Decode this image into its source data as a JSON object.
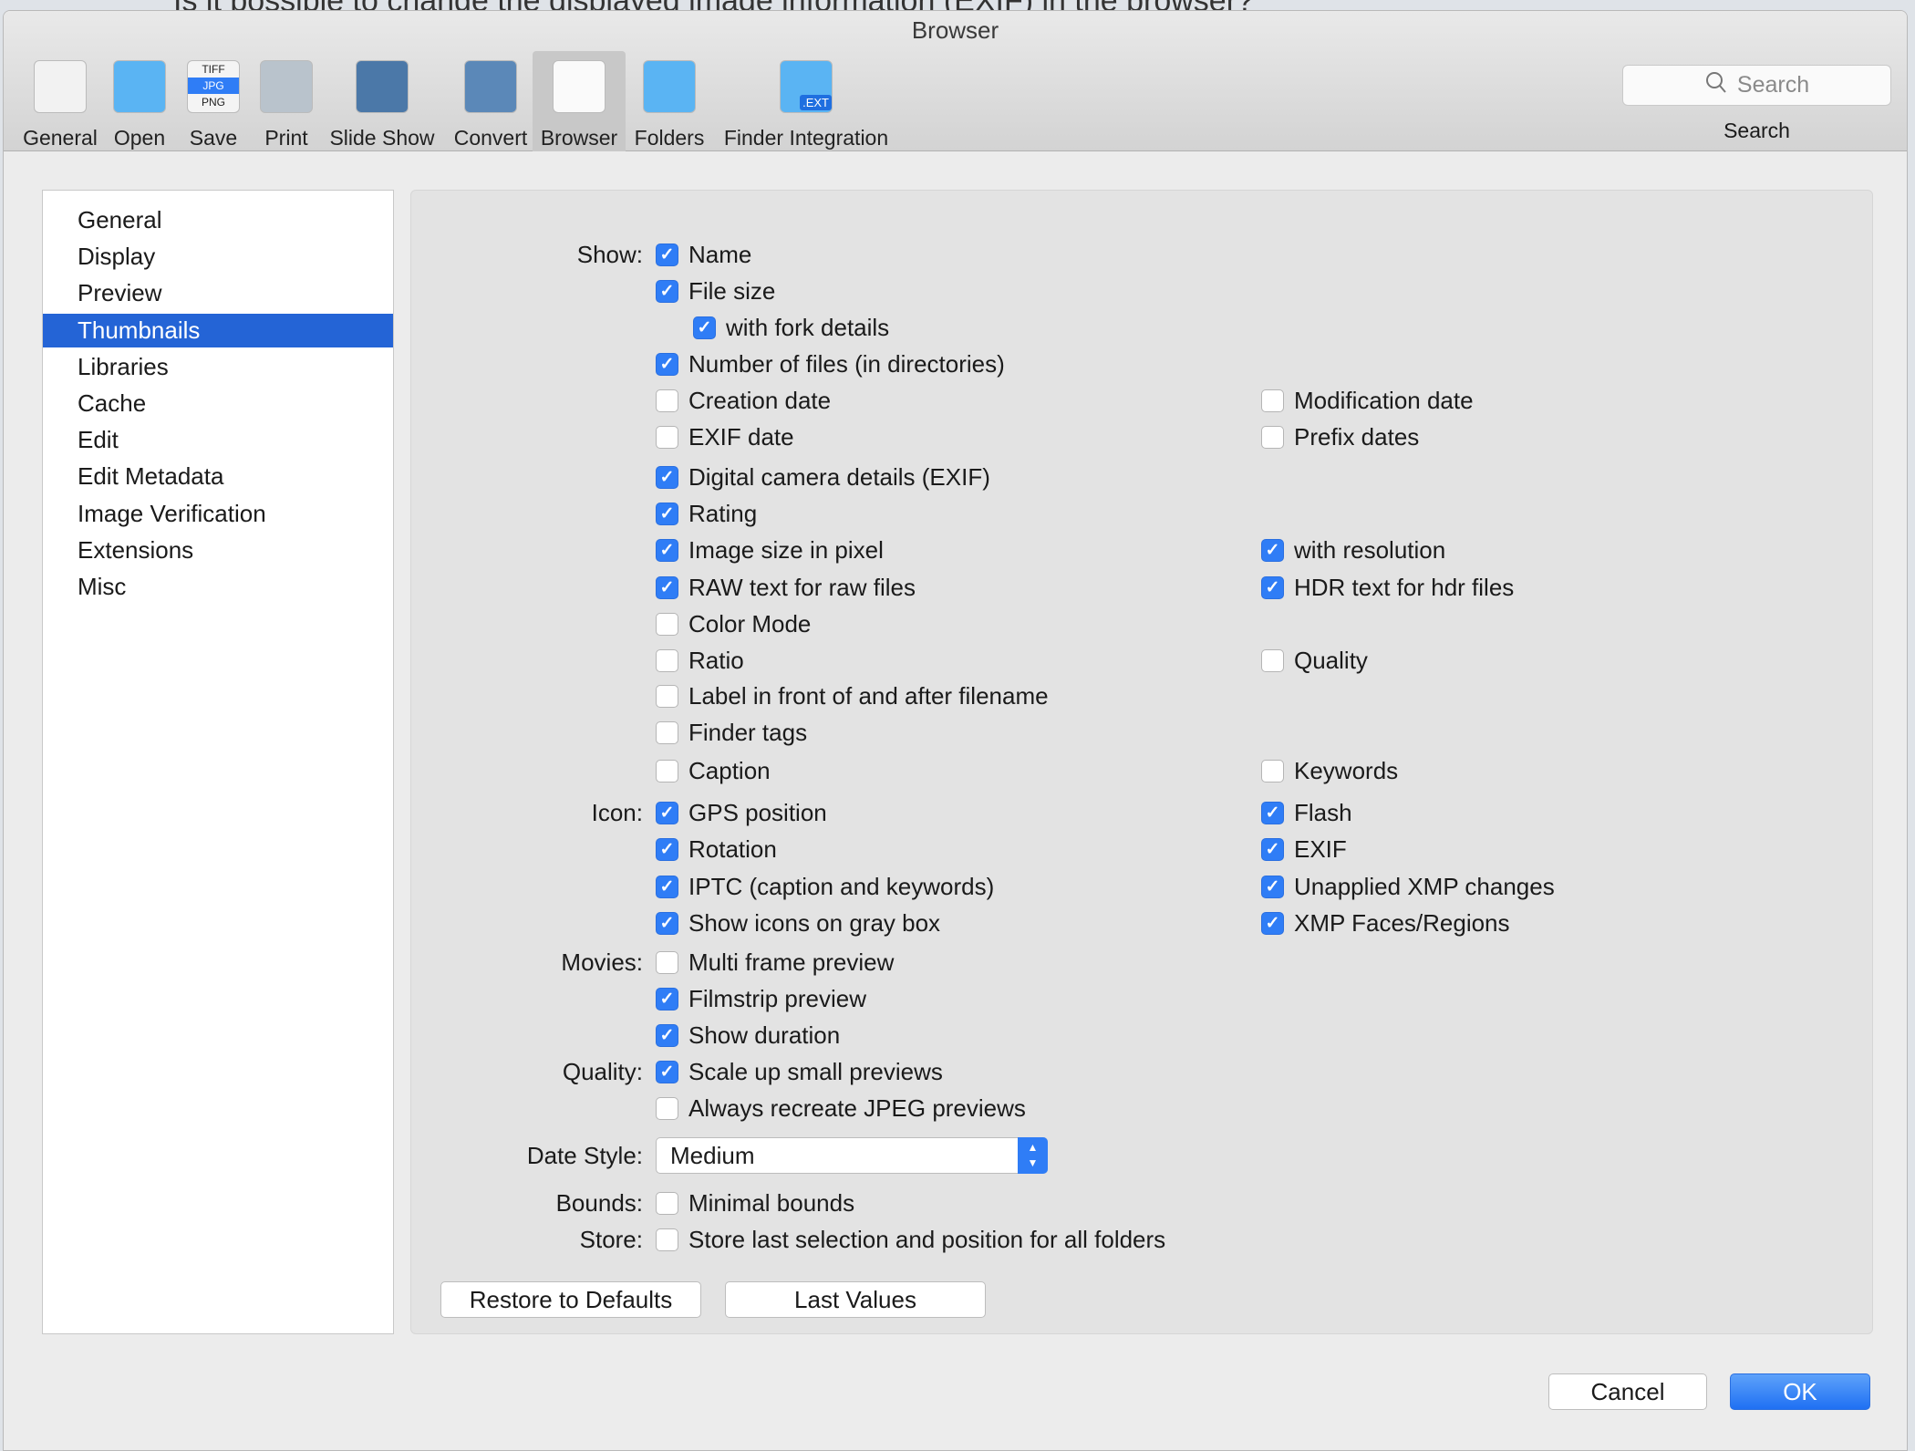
{
  "background_question": "Is it possible to change the displayed image information (EXIF) in the browser?",
  "window": {
    "title": "Browser"
  },
  "toolbar": {
    "items": [
      {
        "label": "General",
        "icon": "switch-icon"
      },
      {
        "label": "Open",
        "icon": "folder-brush-icon"
      },
      {
        "label": "Save",
        "icon": "file-formats-icon",
        "formats": [
          "TIFF",
          "JPG",
          "PNG"
        ]
      },
      {
        "label": "Print",
        "icon": "printer-icon"
      },
      {
        "label": "Slide Show",
        "icon": "slideshow-icon"
      },
      {
        "label": "Convert",
        "icon": "convert-icon"
      },
      {
        "label": "Browser",
        "icon": "browser-icon",
        "selected": true
      },
      {
        "label": "Folders",
        "icon": "folder-photo-icon"
      },
      {
        "label": "Finder Integration",
        "icon": "finder-ext-icon",
        "badge": ".EXT"
      }
    ],
    "search": {
      "placeholder": "Search",
      "label": "Search"
    }
  },
  "sidebar": {
    "items": [
      "General",
      "Display",
      "Preview",
      "Thumbnails",
      "Libraries",
      "Cache",
      "Edit",
      "Edit Metadata",
      "Image Verification",
      "Extensions",
      "Misc"
    ],
    "selected": "Thumbnails"
  },
  "rows": [
    {
      "group": "Show:",
      "left": {
        "label": "Name",
        "checked": true
      }
    },
    {
      "left": {
        "label": "File size",
        "checked": true
      }
    },
    {
      "left": {
        "label": "with fork details",
        "checked": true,
        "indent": true
      }
    },
    {
      "left": {
        "label": "Number of files (in directories)",
        "checked": true
      }
    },
    {
      "left": {
        "label": "Creation date",
        "checked": false
      },
      "right": {
        "label": "Modification date",
        "checked": false
      }
    },
    {
      "left": {
        "label": "EXIF date",
        "checked": false
      },
      "right": {
        "label": "Prefix dates",
        "checked": false
      }
    },
    {
      "left": {
        "label": "Digital camera details (EXIF)",
        "checked": true
      }
    },
    {
      "left": {
        "label": "Rating",
        "checked": true
      }
    },
    {
      "left": {
        "label": "Image size in pixel",
        "checked": true
      },
      "right": {
        "label": "with resolution",
        "checked": true
      }
    },
    {
      "left": {
        "label": "RAW text for raw files",
        "checked": true
      },
      "right": {
        "label": "HDR text for hdr files",
        "checked": true
      }
    },
    {
      "left": {
        "label": "Color Mode",
        "checked": false
      }
    },
    {
      "left": {
        "label": "Ratio",
        "checked": false
      },
      "right": {
        "label": "Quality",
        "checked": false
      }
    },
    {
      "left": {
        "label": "Label in front of and after filename",
        "checked": false
      }
    },
    {
      "left": {
        "label": "Finder tags",
        "checked": false
      }
    },
    {
      "left": {
        "label": "Caption",
        "checked": false
      },
      "right": {
        "label": "Keywords",
        "checked": false
      }
    },
    {
      "group": "Icon:",
      "left": {
        "label": "GPS position",
        "checked": true
      },
      "right": {
        "label": "Flash",
        "checked": true
      }
    },
    {
      "left": {
        "label": "Rotation",
        "checked": true
      },
      "right": {
        "label": "EXIF",
        "checked": true
      }
    },
    {
      "left": {
        "label": "IPTC (caption and keywords)",
        "checked": true
      },
      "right": {
        "label": "Unapplied XMP changes",
        "checked": true
      }
    },
    {
      "left": {
        "label": "Show icons on gray box",
        "checked": true
      },
      "right": {
        "label": "XMP Faces/Regions",
        "checked": true
      }
    },
    {
      "group": "Movies:",
      "left": {
        "label": "Multi frame preview",
        "checked": false
      }
    },
    {
      "left": {
        "label": "Filmstrip preview",
        "checked": true
      }
    },
    {
      "left": {
        "label": "Show duration",
        "checked": true
      }
    },
    {
      "group": "Quality:",
      "left": {
        "label": "Scale up small previews",
        "checked": true
      }
    },
    {
      "left": {
        "label": "Always recreate JPEG previews",
        "checked": false
      }
    },
    {
      "group": "Date Style:",
      "select": "Medium"
    },
    {
      "group": "Bounds:",
      "left": {
        "label": "Minimal bounds",
        "checked": false
      }
    },
    {
      "group": "Store:",
      "left": {
        "label": "Store last selection and position for all folders",
        "checked": false
      }
    }
  ],
  "buttons": {
    "restore": "Restore to Defaults",
    "last": "Last Values",
    "cancel": "Cancel",
    "ok": "OK"
  },
  "colors": {
    "accent": "#2f7df6",
    "selection": "#2464d6"
  }
}
